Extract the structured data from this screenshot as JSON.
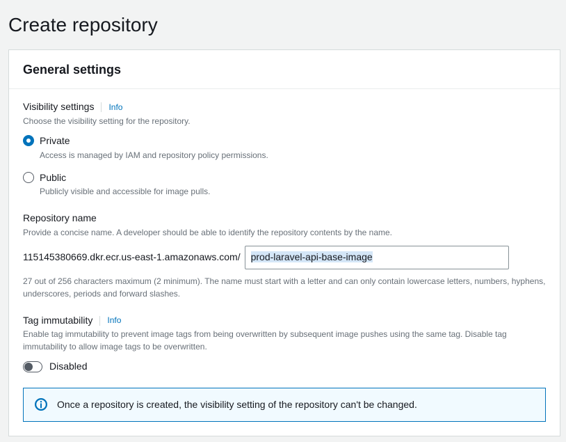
{
  "page": {
    "title": "Create repository"
  },
  "panel": {
    "title": "General settings"
  },
  "visibility": {
    "label": "Visibility settings",
    "info": "Info",
    "desc": "Choose the visibility setting for the repository.",
    "options": {
      "private": {
        "label": "Private",
        "sub": "Access is managed by IAM and repository policy permissions."
      },
      "public": {
        "label": "Public",
        "sub": "Publicly visible and accessible for image pulls."
      }
    }
  },
  "repo": {
    "label": "Repository name",
    "desc": "Provide a concise name. A developer should be able to identify the repository contents by the name.",
    "prefix": "115145380669.dkr.ecr.us-east-1.amazonaws.com/",
    "value": "prod-laravel-api-base-image",
    "helper": "27 out of 256 characters maximum (2 minimum). The name must start with a letter and can only contain lowercase letters, numbers, hyphens, underscores, periods and forward slashes."
  },
  "tag": {
    "label": "Tag immutability",
    "info": "Info",
    "desc": "Enable tag immutability to prevent image tags from being overwritten by subsequent image pushes using the same tag. Disable tag immutability to allow image tags to be overwritten.",
    "state": "Disabled"
  },
  "alert": {
    "text": "Once a repository is created, the visibility setting of the repository can't be changed."
  }
}
